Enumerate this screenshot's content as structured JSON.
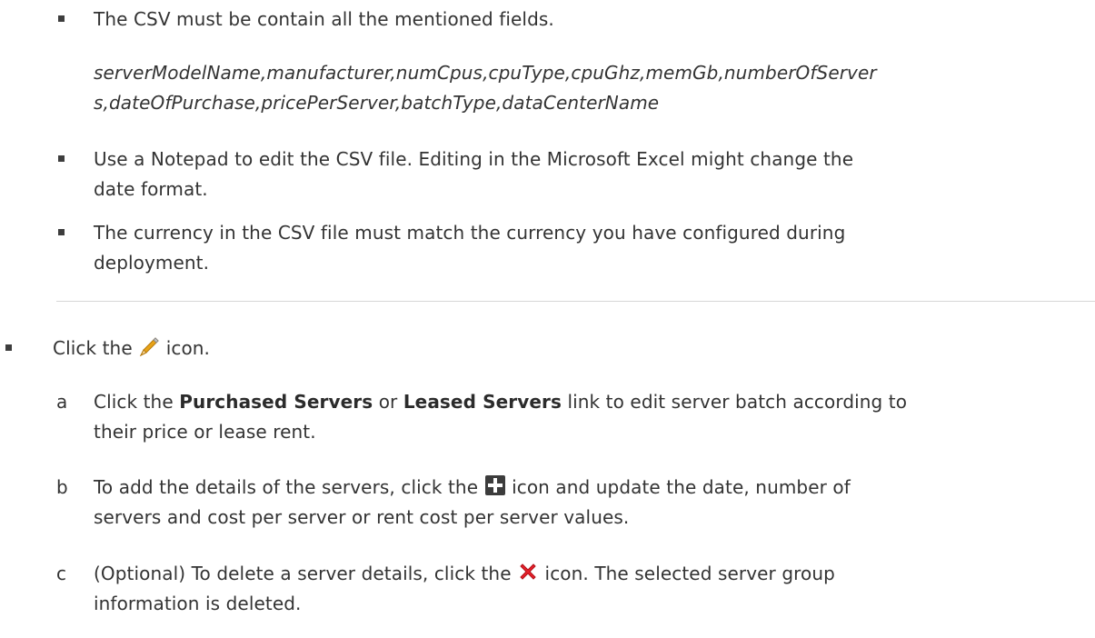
{
  "notes": {
    "csv_fields_note": "The CSV must be contain all the mentioned fields.",
    "csv_fields_line1": "serverModelName,manufacturer,numCpus,cpuType,cpuGhz,memGb,numberOfServer",
    "csv_fields_line2": "s,dateOfPurchase,pricePerServer,batchType,dataCenterName",
    "notepad_line1": "Use a Notepad to edit the CSV file. Editing in the Microsoft Excel might change the",
    "notepad_line2": "date format.",
    "currency_line1": "The currency in the CSV file must match the currency you have configured during",
    "currency_line2": "deployment."
  },
  "main_step": {
    "prefix": "Click the",
    "icon": "pencil-icon",
    "suffix": "icon."
  },
  "substeps": [
    {
      "letter": "a",
      "prefix": "Click the",
      "link1": "Purchased Servers",
      "middle": "or",
      "link2": "Leased Servers",
      "suffix": "link to edit server batch according to",
      "line2": "their price or lease rent."
    },
    {
      "letter": "b",
      "prefix": "To add the details of the servers, click the",
      "icon": "add-icon",
      "suffix": "icon and update the date, number of",
      "line2": "servers and cost per server or rent cost per server values."
    },
    {
      "letter": "c",
      "prefix": "(Optional) To delete a server details, click the",
      "icon": "delete-icon",
      "suffix": "icon. The selected server group",
      "line2": "information is deleted."
    }
  ],
  "colors": {
    "text": "#333333",
    "add_icon": "#3c3c3c",
    "delete_icon": "#e8202a",
    "pencil": "#e8a317"
  }
}
